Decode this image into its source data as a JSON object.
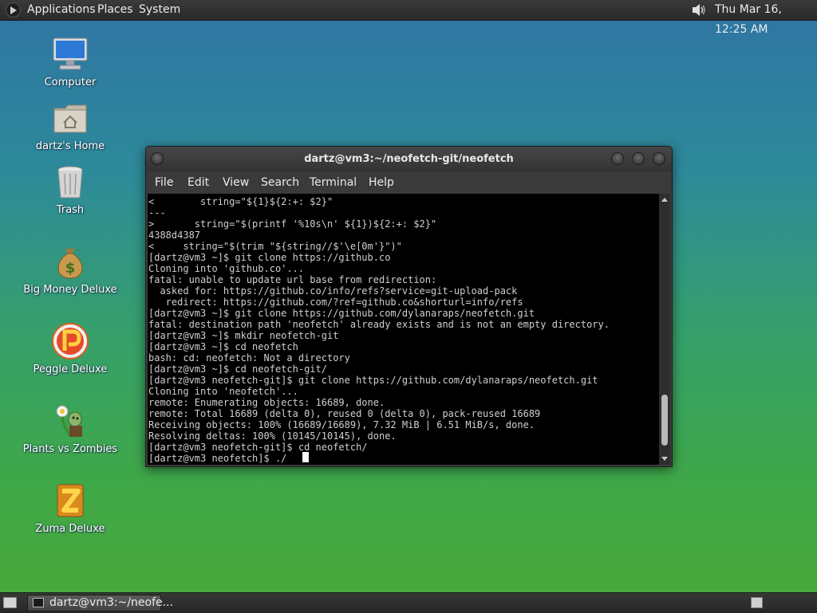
{
  "top_panel": {
    "menus": [
      "Applications",
      "Places",
      "System"
    ],
    "clock": "Thu Mar 16, 12:25 AM",
    "icons": {
      "logo": "gnome-foot-icon",
      "volume": "speaker-icon"
    }
  },
  "desktop": {
    "icons": [
      {
        "label": "Computer",
        "icon": "monitor-icon"
      },
      {
        "label": "dartz's Home",
        "icon": "home-folder-icon"
      },
      {
        "label": "Trash",
        "icon": "trash-icon"
      },
      {
        "label": "Big Money Deluxe",
        "icon": "money-bag-icon"
      },
      {
        "label": "Peggle Deluxe",
        "icon": "peggle-icon"
      },
      {
        "label": "Plants vs Zombies",
        "icon": "plants-zombies-icon"
      },
      {
        "label": "Zuma Deluxe",
        "icon": "zuma-icon"
      }
    ]
  },
  "terminal": {
    "title": "dartz@vm3:~/neofetch-git/neofetch",
    "menu": [
      "File",
      "Edit",
      "View",
      "Search",
      "Terminal",
      "Help"
    ],
    "lines": [
      "<        string=\"${1}${2:+: $2}\"",
      "---",
      ">       string=\"$(printf '%10s\\n' ${1})${2:+: $2}\"",
      "4388d4387",
      "<     string=\"$(trim \"${string//$'\\e[0m'}\")\"",
      "[dartz@vm3 ~]$ git clone https://github.co",
      "Cloning into 'github.co'...",
      "fatal: unable to update url base from redirection:",
      "  asked for: https://github.co/info/refs?service=git-upload-pack",
      "   redirect: https://github.com/?ref=github.co&shorturl=info/refs",
      "[dartz@vm3 ~]$ git clone https://github.com/dylanaraps/neofetch.git",
      "fatal: destination path 'neofetch' already exists and is not an empty directory.",
      "[dartz@vm3 ~]$ mkdir neofetch-git",
      "[dartz@vm3 ~]$ cd neofetch",
      "bash: cd: neofetch: Not a directory",
      "[dartz@vm3 ~]$ cd neofetch-git/",
      "[dartz@vm3 neofetch-git]$ git clone https://github.com/dylanaraps/neofetch.git",
      "Cloning into 'neofetch'...",
      "remote: Enumerating objects: 16689, done.",
      "remote: Total 16689 (delta 0), reused 0 (delta 0), pack-reused 16689",
      "Receiving objects: 100% (16689/16689), 7.32 MiB | 6.51 MiB/s, done.",
      "Resolving deltas: 100% (10145/10145), done.",
      "[dartz@vm3 neofetch-git]$ cd neofetch/",
      "[dartz@vm3 neofetch]$ ./"
    ]
  },
  "bottom_panel": {
    "task_label": "dartz@vm3:~/neofe...",
    "icons": {
      "show_desktop": "show-desktop-icon",
      "task": "terminal-icon",
      "workspace": "workspace-switcher-icon"
    }
  }
}
